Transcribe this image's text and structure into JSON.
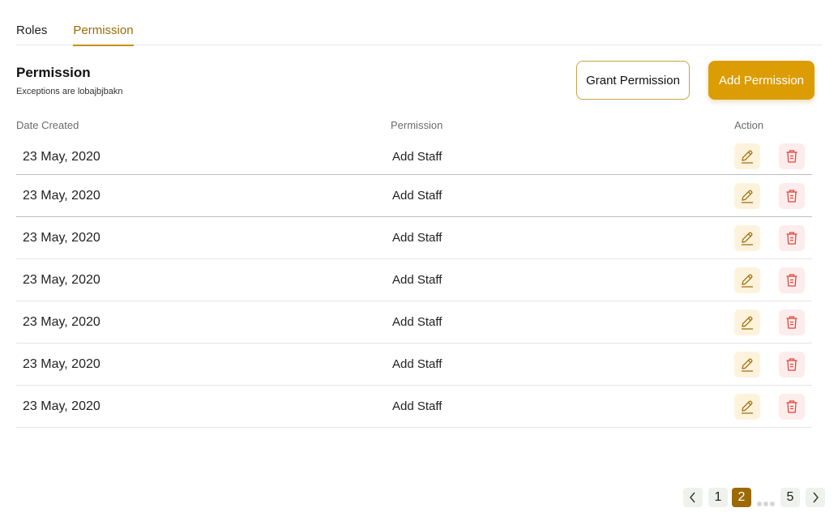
{
  "tabs": [
    {
      "label": "Roles",
      "active": false
    },
    {
      "label": "Permission",
      "active": true
    }
  ],
  "header": {
    "title": "Permission",
    "subtitle": "Exceptions are lobajbjbakn"
  },
  "buttons": {
    "grant_label": "Grant Permission",
    "add_label": "Add Permission"
  },
  "table": {
    "columns": [
      "Date Created",
      "Permission",
      "Action"
    ],
    "rows": [
      {
        "date": "23 May, 2020",
        "permission": "Add Staff"
      },
      {
        "date": "23 May, 2020",
        "permission": "Add Staff"
      },
      {
        "date": "23 May, 2020",
        "permission": "Add Staff"
      },
      {
        "date": "23 May, 2020",
        "permission": "Add Staff"
      },
      {
        "date": "23 May, 2020",
        "permission": "Add Staff"
      },
      {
        "date": "23 May, 2020",
        "permission": "Add Staff"
      },
      {
        "date": "23 May, 2020",
        "permission": "Add Staff"
      }
    ],
    "row_actions": [
      "edit-icon",
      "trash-icon"
    ]
  },
  "pagination": {
    "pages": [
      "1",
      "2",
      "5"
    ],
    "current": "2",
    "icons": [
      "chevron-left-icon",
      "ellipsis-icon",
      "chevron-right-icon"
    ]
  },
  "colors": {
    "accent": "#dc9c03",
    "accent_dark": "#9b6a06",
    "delete": "#e0473d"
  }
}
